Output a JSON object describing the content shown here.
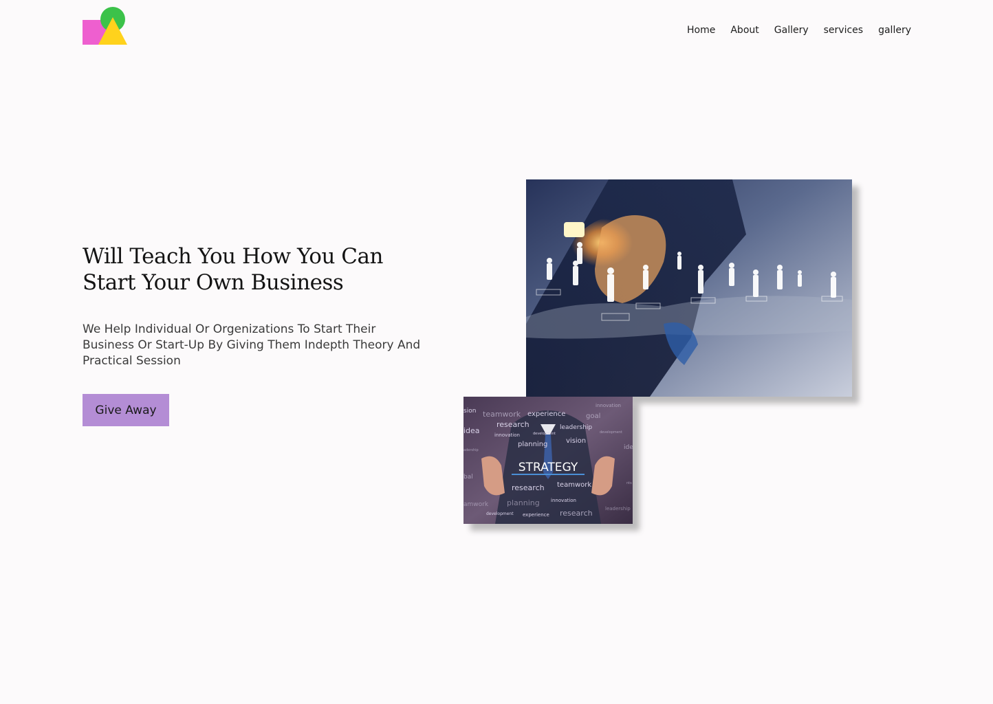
{
  "header": {
    "logo_icon": "geometric-shapes-logo",
    "nav": [
      {
        "label": "Home"
      },
      {
        "label": "About"
      },
      {
        "label": "Gallery"
      },
      {
        "label": "services"
      },
      {
        "label": "gallery"
      }
    ]
  },
  "hero": {
    "title": "Will Teach You How You Can Start Your Own Business",
    "subtitle": "We Help Individual Or Orgenizations To Start Their Business Or Start-Up By Giving Them Indepth Theory And Practical Session",
    "cta_label": "Give Away"
  },
  "images": {
    "main": {
      "description_icon": "business-network-image"
    },
    "secondary": {
      "headline": "STRATEGY",
      "words": [
        "sion",
        "teamwork",
        "experience",
        "goal",
        "innovation",
        "research",
        "leadership",
        "idea",
        "innovation",
        "development",
        "development",
        "planning",
        "vision",
        "ide",
        "adership",
        "bal",
        "research",
        "teamwork",
        "nts",
        "innovation",
        "amwork",
        "planning",
        "leadership",
        "development",
        "experience",
        "research"
      ]
    }
  },
  "colors": {
    "background": "#fcfafb",
    "cta": "#b48dd5",
    "logo_pink": "#ee5fcf",
    "logo_green": "#3cc24a",
    "logo_yellow": "#ffd21c"
  }
}
